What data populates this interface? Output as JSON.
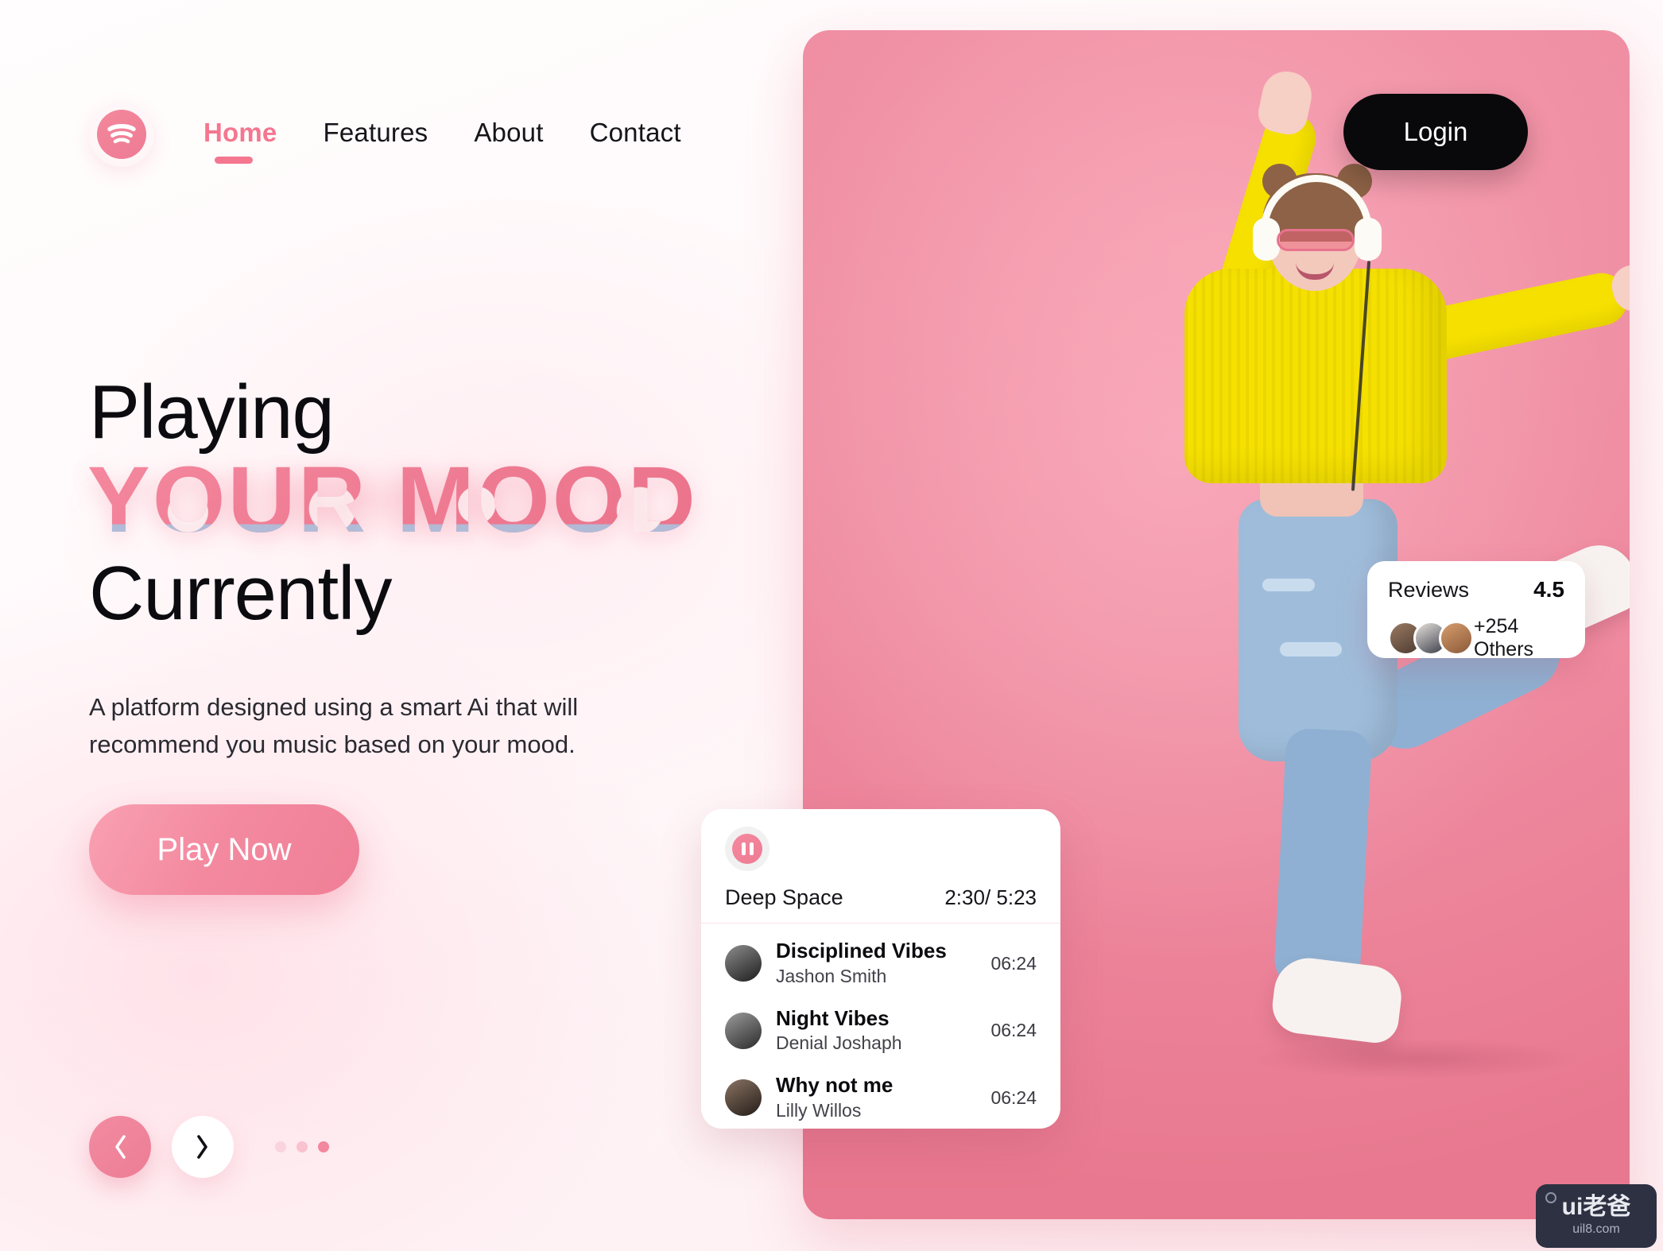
{
  "brand": {
    "logo_icon": "spotify-wave-icon"
  },
  "nav": {
    "items": [
      {
        "label": "Home",
        "active": true
      },
      {
        "label": "Features",
        "active": false
      },
      {
        "label": "About",
        "active": false
      },
      {
        "label": "Contact",
        "active": false
      }
    ]
  },
  "header": {
    "login_label": "Login"
  },
  "hero": {
    "headline_line1": "Playing",
    "headline_highlight": "YOUR MOOD",
    "headline_line3": "Currently",
    "subtext": "A platform designed using a smart Ai that will recommend you music based on your mood.",
    "cta_label": "Play Now"
  },
  "carousel": {
    "prev_icon": "chevron-left-icon",
    "next_icon": "chevron-right-icon",
    "dots": 3,
    "active_dot_index": 2
  },
  "reviews": {
    "label": "Reviews",
    "score": "4.5",
    "others": "+254 Others",
    "avatars": [
      "reviewer-avatar-1",
      "reviewer-avatar-2",
      "reviewer-avatar-3"
    ]
  },
  "player": {
    "pause_icon": "pause-icon",
    "now_playing": "Deep Space",
    "time": "2:30/ 5:23",
    "tracks": [
      {
        "name": "Disciplined Vibes",
        "artist": "Jashon Smith",
        "duration": "06:24"
      },
      {
        "name": "Night Vibes",
        "artist": "Denial Joshaph",
        "duration": "06:24"
      },
      {
        "name": "Why not me",
        "artist": "Lilly Willos",
        "duration": "06:24"
      }
    ]
  },
  "watermark": {
    "main": "ui老爸",
    "sub": "uil8.com"
  },
  "colors": {
    "accent_pink": "#f4778f",
    "hero_pink": "#ef8298",
    "dark": "#09090b",
    "page_bg": "#fff8fa"
  }
}
